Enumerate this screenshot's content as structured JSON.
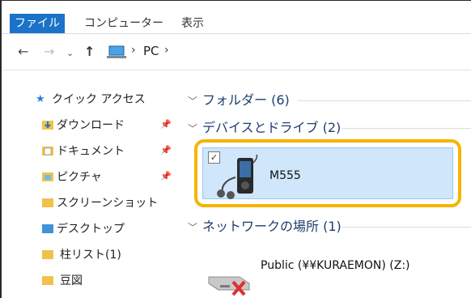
{
  "ribbon": {
    "tabs": [
      "ファイル",
      "コンピューター",
      "表示"
    ]
  },
  "navigation": {
    "back_icon": "←",
    "forward_icon": "→",
    "recent_icon": "⌄",
    "up_icon": "↑",
    "breadcrumb": [
      "PC"
    ]
  },
  "sidebar": {
    "quick_access": "クイック アクセス",
    "items": [
      {
        "label": "ダウンロード",
        "pinned": true
      },
      {
        "label": "ドキュメント",
        "pinned": true
      },
      {
        "label": "ピクチャ",
        "pinned": true
      },
      {
        "label": "スクリーンショット",
        "pinned": false
      },
      {
        "label": "デスクトップ",
        "pinned": false
      },
      {
        "label": "柱リスト(1)",
        "pinned": false
      },
      {
        "label": "豆図",
        "pinned": false
      }
    ]
  },
  "main": {
    "groups": [
      {
        "label": "フォルダー (6)"
      },
      {
        "label": "デバイスとドライブ (2)"
      },
      {
        "label": "ネットワークの場所 (1)"
      }
    ],
    "device": {
      "label": "M555",
      "checked": true
    },
    "network_location": {
      "label": "Public (¥¥KURAEMON) (Z:)"
    }
  },
  "colors": {
    "file_tab": "#1a73c9",
    "selection_bg": "#cfe6fb",
    "highlight_border": "#f6b400"
  }
}
